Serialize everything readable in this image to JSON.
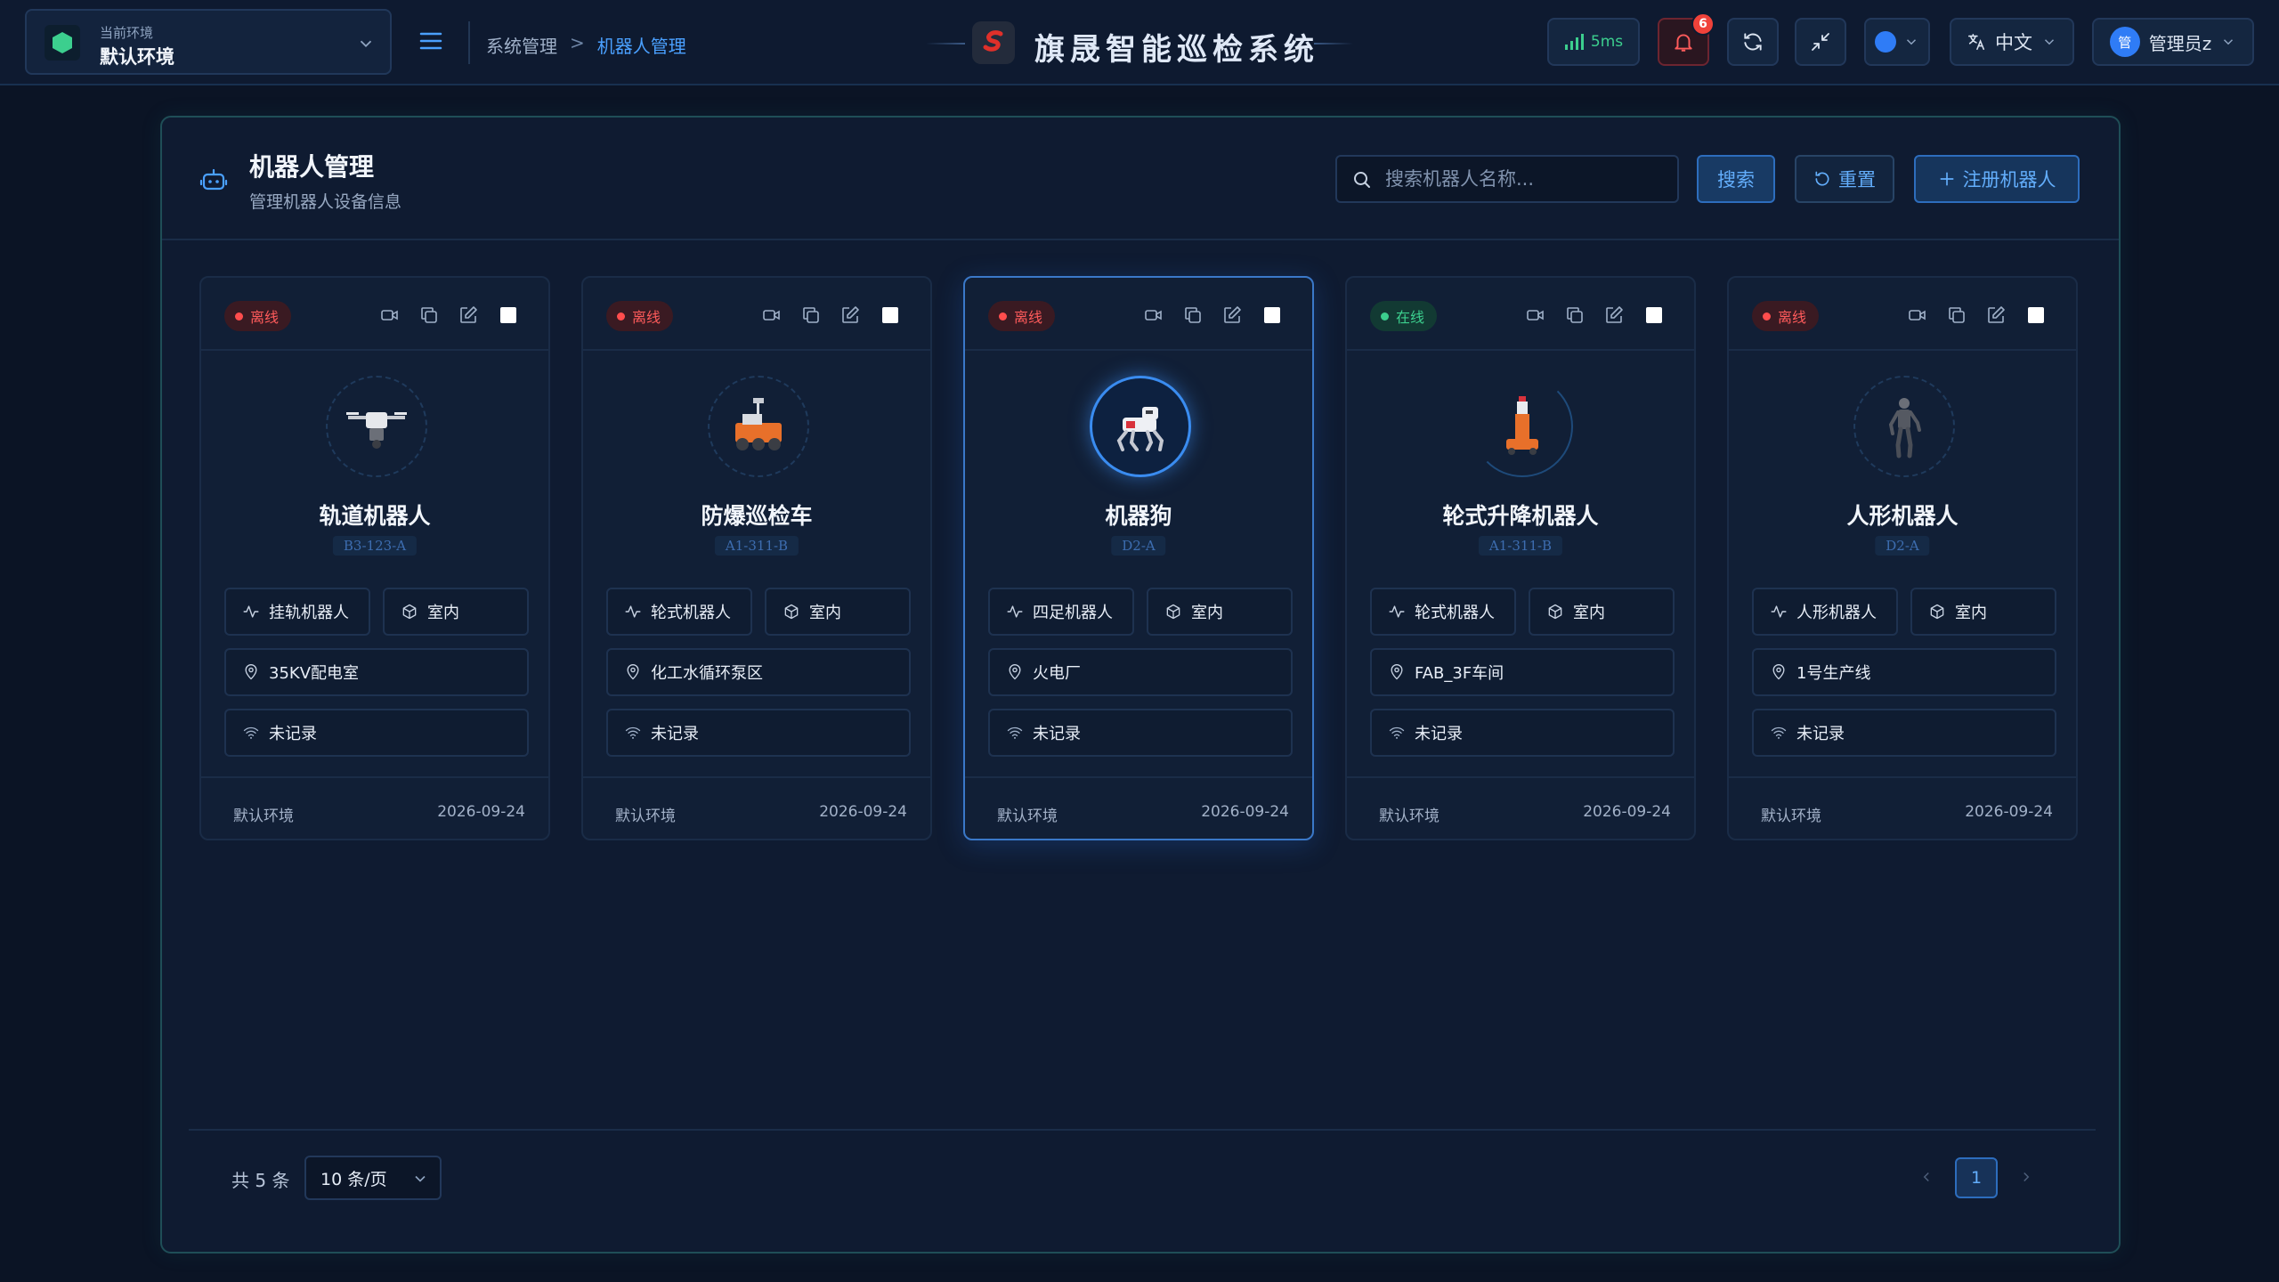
{
  "env": {
    "caption": "当前环境",
    "name": "默认环境"
  },
  "breadcrumb": {
    "parent": "系统管理",
    "separator": ">",
    "current": "机器人管理"
  },
  "app_title": "旗晟智能巡检系统",
  "header": {
    "latency": "5ms",
    "notification_count": "6",
    "language": "中文",
    "user": "管理员z",
    "avatar_text": "管"
  },
  "page": {
    "title": "机器人管理",
    "subtitle": "管理机器人设备信息",
    "search_placeholder": "搜索机器人名称...",
    "search_label": "搜索",
    "reset_label": "重置",
    "register_label": "注册机器人"
  },
  "colors": {
    "accent": "#2f7cf6",
    "online": "#3ccf8e",
    "offline": "#ff4d4d",
    "panel_border": "#1f4e57"
  },
  "robots": [
    {
      "status": "离线",
      "name": "轨道机器人",
      "code": "B3-123-A",
      "type": "挂轨机器人",
      "place": "室内",
      "location": "35KV配电室",
      "network": "未记录",
      "env": "默认环境",
      "date": "2026-09-24",
      "icon": "rail-drone-icon"
    },
    {
      "status": "离线",
      "name": "防爆巡检车",
      "code": "A1-311-B",
      "type": "轮式机器人",
      "place": "室内",
      "location": "化工水循环泵区",
      "network": "未记录",
      "env": "默认环境",
      "date": "2026-09-24",
      "icon": "explosion-proof-vehicle-icon"
    },
    {
      "status": "离线",
      "name": "机器狗",
      "code": "D2-A",
      "type": "四足机器人",
      "place": "室内",
      "location": "火电厂",
      "network": "未记录",
      "env": "默认环境",
      "date": "2026-09-24",
      "icon": "robot-dog-icon"
    },
    {
      "status": "在线",
      "name": "轮式升降机器人",
      "code": "A1-311-B",
      "type": "轮式机器人",
      "place": "室内",
      "location": "FAB_3F车间",
      "network": "未记录",
      "env": "默认环境",
      "date": "2026-09-24",
      "icon": "lift-robot-icon"
    },
    {
      "status": "离线",
      "name": "人形机器人",
      "code": "D2-A",
      "type": "人形机器人",
      "place": "室内",
      "location": "1号生产线",
      "network": "未记录",
      "env": "默认环境",
      "date": "2026-09-24",
      "icon": "humanoid-robot-icon"
    }
  ],
  "pagination": {
    "total": "共 5 条",
    "page_size": "10 条/页",
    "current_page": "1"
  }
}
